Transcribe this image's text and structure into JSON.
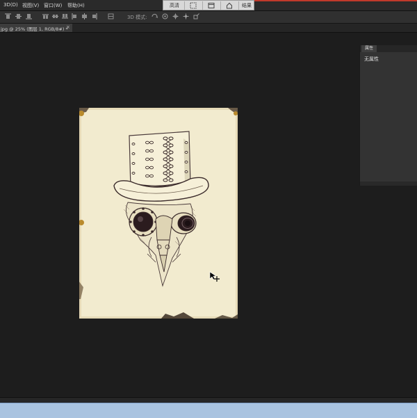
{
  "menu": {
    "items": [
      "3D(D)",
      "视图(V)",
      "窗口(W)",
      "帮助(H)"
    ]
  },
  "screen_mode_bar": {
    "buttons": [
      {
        "label": "高清",
        "icon": "text"
      },
      {
        "label": "",
        "icon": "select-region-icon"
      },
      {
        "label": "",
        "icon": "window-icon"
      },
      {
        "label": "",
        "icon": "home-icon"
      },
      {
        "label": "结果",
        "icon": "text"
      }
    ]
  },
  "options_bar": {
    "mode_3d_label": "3D 模式:"
  },
  "document": {
    "tab_label": "jpg @ 25% (图层 1, RGB/8#) *",
    "close_glyph": "×"
  },
  "panel": {
    "tab_label": "属性",
    "body_text": "无属性"
  },
  "colors": {
    "canvas_bg": "#1d1d1d",
    "paper": "#f2ebcf",
    "ink": "#3a2a2a",
    "accent_red": "#c0392b",
    "taskbar": "#a9c3e0"
  }
}
